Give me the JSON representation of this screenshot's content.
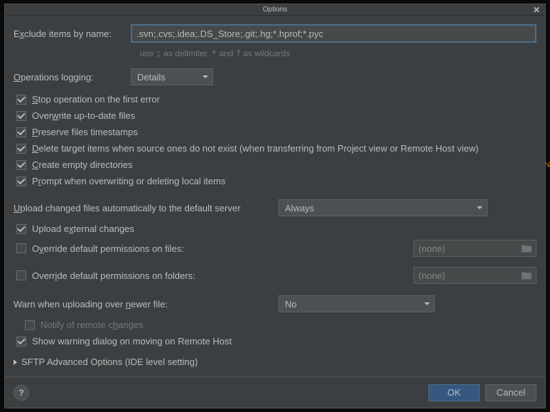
{
  "title": "Options",
  "exclude_label_pre": "E",
  "exclude_label_u": "x",
  "exclude_label_post": "clude items by name:",
  "exclude_value": ".svn;.cvs;.idea;.DS_Store;.git;.hg;*.hprof;*.pyc",
  "hint_pre": "use ",
  "hint_semi": ";",
  "hint_mid1": " as delimiter, ",
  "hint_star": "*",
  "hint_mid2": " and ",
  "hint_q": "?",
  "hint_post": " as wildcards",
  "ops_label_u": "O",
  "ops_label_post": "perations logging:",
  "ops_value": "Details",
  "cb_stop_u": "S",
  "cb_stop_post": "top operation on the first error",
  "cb_overwrite_pre": "Over",
  "cb_overwrite_u": "w",
  "cb_overwrite_post": "rite up-to-date files",
  "cb_preserve_u": "P",
  "cb_preserve_post": "reserve files timestamps",
  "cb_delete_u": "D",
  "cb_delete_post": "elete target items when source ones do not exist (when transferring from Project view or Remote Host view)",
  "cb_create_u": "C",
  "cb_create_post": "reate empty directories",
  "cb_prompt_pre": "P",
  "cb_prompt_u": "r",
  "cb_prompt_post": "ompt when overwriting or deleting local items",
  "upload_label_u": "U",
  "upload_label_post": "pload changed files automatically to the default server",
  "upload_value": "Always",
  "cb_ext_pre": "Upload e",
  "cb_ext_u": "x",
  "cb_ext_post": "ternal changes",
  "cb_ovfiles_pre": "O",
  "cb_ovfiles_u": "v",
  "cb_ovfiles_post": "erride default permissions on files:",
  "perm_none": "(none)",
  "cb_ovfolders_pre": "Overr",
  "cb_ovfolders_u": "i",
  "cb_ovfolders_post": "de default permissions on folders:",
  "warn_pre": "Warn when uploading over ",
  "warn_u": "n",
  "warn_post": "ewer file:",
  "warn_value": "No",
  "cb_notify_pre": "Notify of remote c",
  "cb_notify_u": "h",
  "cb_notify_post": "anges",
  "cb_showwarn": "Show warning dialog on moving on Remote Host",
  "expander": "SFTP Advanced Options (IDE level setting)",
  "help_q": "?",
  "ok": "OK",
  "cancel": "Cancel"
}
